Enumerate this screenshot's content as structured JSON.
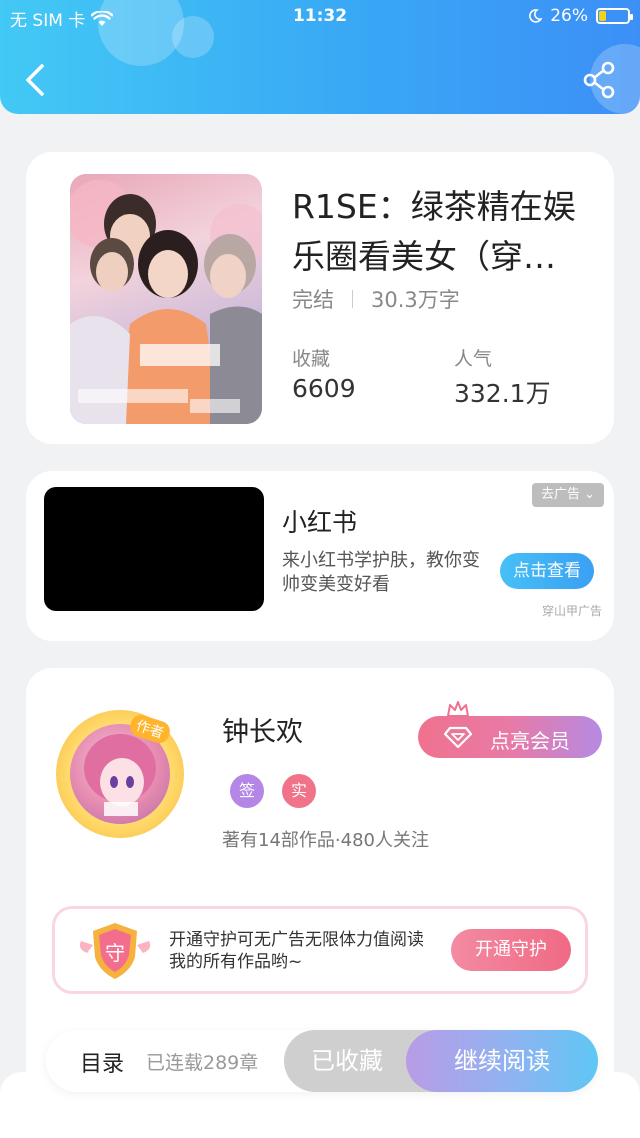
{
  "status_bar": {
    "carrier": "无 SIM 卡",
    "time": "11:32",
    "battery": "26%",
    "battery_level": 0.26
  },
  "header": {
    "back_icon": "chevron-left-icon",
    "share_icon": "share-icon"
  },
  "book": {
    "title": "R1SE：绿茶精在娱乐圈看美女（穿…",
    "status": "完结",
    "word_count": "30.3万字",
    "favorites_label": "收藏",
    "favorites_value": "6609",
    "popularity_label": "人气",
    "popularity_value": "332.1万"
  },
  "ad": {
    "title": "小红书",
    "description": "来小红书学护肤，教你变帅变美变好看",
    "button": "点击查看",
    "close_label": "去广告",
    "source": "穿山甲广告"
  },
  "author": {
    "tag": "作者",
    "name": "钟长欢",
    "badge_signed": "签",
    "badge_real": "实",
    "stats": "著有14部作品·480人关注",
    "vip_button": "点亮会员",
    "guard_icon_text": "守",
    "guard_text": "开通守护可无广告无限体力值阅读我的所有作品哟~",
    "guard_button": "开通守护"
  },
  "bottom": {
    "toc": "目录",
    "chapters": "已连载289章",
    "favorited": "已收藏",
    "continue": "继续阅读"
  },
  "colors": {
    "header": "#3aa8f5",
    "vip_gradient_start": "#f0728e",
    "read_gradient_end": "#5ec7f5"
  }
}
